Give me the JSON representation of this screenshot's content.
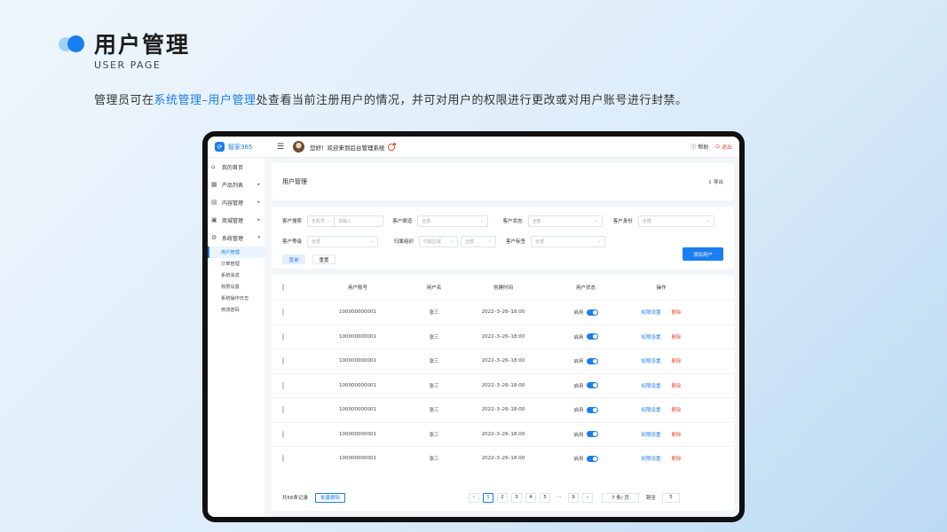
{
  "slide": {
    "title": "用户管理",
    "subtitle": "USER PAGE",
    "desc_before": "管理员可在",
    "desc_highlight": "系统管理–用户管理",
    "desc_after": "处查看当前注册用户的情况，并可对用户的权限进行更改或对用户账号进行封禁。",
    "accent_color": "#1a7df0"
  },
  "app": {
    "brand": "智家365",
    "greeting": "您好！欢迎来到后台管理系统",
    "help": "帮助",
    "logout": "退出"
  },
  "sidebar": {
    "items": [
      {
        "label": "我的首页",
        "icon": "home-icon"
      },
      {
        "label": "产品列表",
        "icon": "grid-icon"
      },
      {
        "label": "内容管理",
        "icon": "document-icon"
      },
      {
        "label": "商城管理",
        "icon": "mall-icon"
      },
      {
        "label": "系统管理",
        "icon": "gear-icon"
      }
    ],
    "sub_items": [
      "用户管理",
      "订单管理",
      "系统消息",
      "权限设置",
      "系统操作日志",
      "修改密码"
    ]
  },
  "main": {
    "title": "用户管理",
    "export": "导出"
  },
  "filters": {
    "search_label": "客户搜索",
    "search_type": "手机号",
    "search_placeholder": "请输入",
    "channel_label": "客户渠道",
    "channel_value": "全部",
    "status_label": "客户状态",
    "status_value": "全部",
    "identity_label": "客户身份",
    "identity_value": "全部",
    "level_label": "客户等级",
    "level_value": "全部",
    "org_label": "归属组织",
    "org_region": "归属区域",
    "org_value": "全部",
    "tag_label": "客户标签",
    "tag_value": "全部",
    "query": "查询",
    "reset": "重置",
    "add_user": "添加用户"
  },
  "table": {
    "headers": [
      "用户账号",
      "用户名",
      "创建时间",
      "用户状态",
      "操作"
    ],
    "rows": [
      {
        "account": "100000000001",
        "name": "张三",
        "created": "2022–3–26–18:00",
        "status": "启用",
        "perm": "权限设置",
        "del": "删除"
      },
      {
        "account": "100000000001",
        "name": "张三",
        "created": "2022–3–26–18:00",
        "status": "启用",
        "perm": "权限设置",
        "del": "删除"
      },
      {
        "account": "100000000001",
        "name": "张三",
        "created": "2022–3–26–18:00",
        "status": "启用",
        "perm": "权限设置",
        "del": "删除"
      },
      {
        "account": "100000000001",
        "name": "张三",
        "created": "2022–3–26–18:00",
        "status": "启用",
        "perm": "权限设置",
        "del": "删除"
      },
      {
        "account": "100000000001",
        "name": "张三",
        "created": "2022–3–26–18:00",
        "status": "启用",
        "perm": "权限设置",
        "del": "删除"
      },
      {
        "account": "100000000001",
        "name": "张三",
        "created": "2022–3–26–18:00",
        "status": "启用",
        "perm": "权限设置",
        "del": "删除"
      },
      {
        "account": "100000000001",
        "name": "张三",
        "created": "2022–3–26–18:00",
        "status": "启用",
        "perm": "权限设置",
        "del": "删除"
      }
    ]
  },
  "footer": {
    "total": "共56条记录",
    "bulk_delete": "批量删除",
    "pages": [
      "1",
      "2",
      "3",
      "4",
      "5"
    ],
    "ellipsis": "···",
    "last_page": "9",
    "per_page": "7 条/ 页",
    "jump_label": "跳至",
    "jump_value": "5"
  }
}
